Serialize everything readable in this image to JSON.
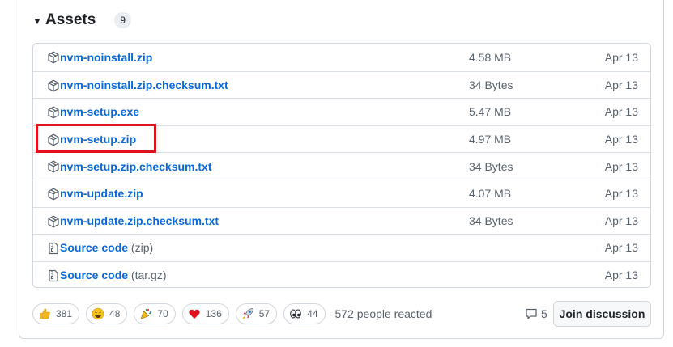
{
  "assets": {
    "title": "Assets",
    "count": "9",
    "items": [
      {
        "name": "nvm-noinstall.zip",
        "format": "",
        "size": "4.58 MB",
        "date": "Apr 13",
        "icon": "package-icon"
      },
      {
        "name": "nvm-noinstall.zip.checksum.txt",
        "format": "",
        "size": "34 Bytes",
        "date": "Apr 13",
        "icon": "package-icon"
      },
      {
        "name": "nvm-setup.exe",
        "format": "",
        "size": "5.47 MB",
        "date": "Apr 13",
        "icon": "package-icon"
      },
      {
        "name": "nvm-setup.zip",
        "format": "",
        "size": "4.97 MB",
        "date": "Apr 13",
        "icon": "package-icon"
      },
      {
        "name": "nvm-setup.zip.checksum.txt",
        "format": "",
        "size": "34 Bytes",
        "date": "Apr 13",
        "icon": "package-icon"
      },
      {
        "name": "nvm-update.zip",
        "format": "",
        "size": "4.07 MB",
        "date": "Apr 13",
        "icon": "package-icon"
      },
      {
        "name": "nvm-update.zip.checksum.txt",
        "format": "",
        "size": "34 Bytes",
        "date": "Apr 13",
        "icon": "package-icon"
      },
      {
        "name": "Source code",
        "format": "(zip)",
        "size": "",
        "date": "Apr 13",
        "icon": "file-zip-icon"
      },
      {
        "name": "Source code",
        "format": "(tar.gz)",
        "size": "",
        "date": "Apr 13",
        "icon": "file-zip-icon"
      }
    ]
  },
  "reactions": [
    {
      "emoji": "thumbs-up",
      "count": "381"
    },
    {
      "emoji": "laugh",
      "count": "48"
    },
    {
      "emoji": "hooray",
      "count": "70"
    },
    {
      "emoji": "heart",
      "count": "136"
    },
    {
      "emoji": "rocket",
      "count": "57"
    },
    {
      "emoji": "eyes",
      "count": "44"
    }
  ],
  "reacted_text": "572 people reacted",
  "comments_count": "5",
  "join_button": "Join discussion",
  "colors": {
    "link": "#0969da",
    "highlight": "#e0101e",
    "border": "#d0d7de"
  }
}
